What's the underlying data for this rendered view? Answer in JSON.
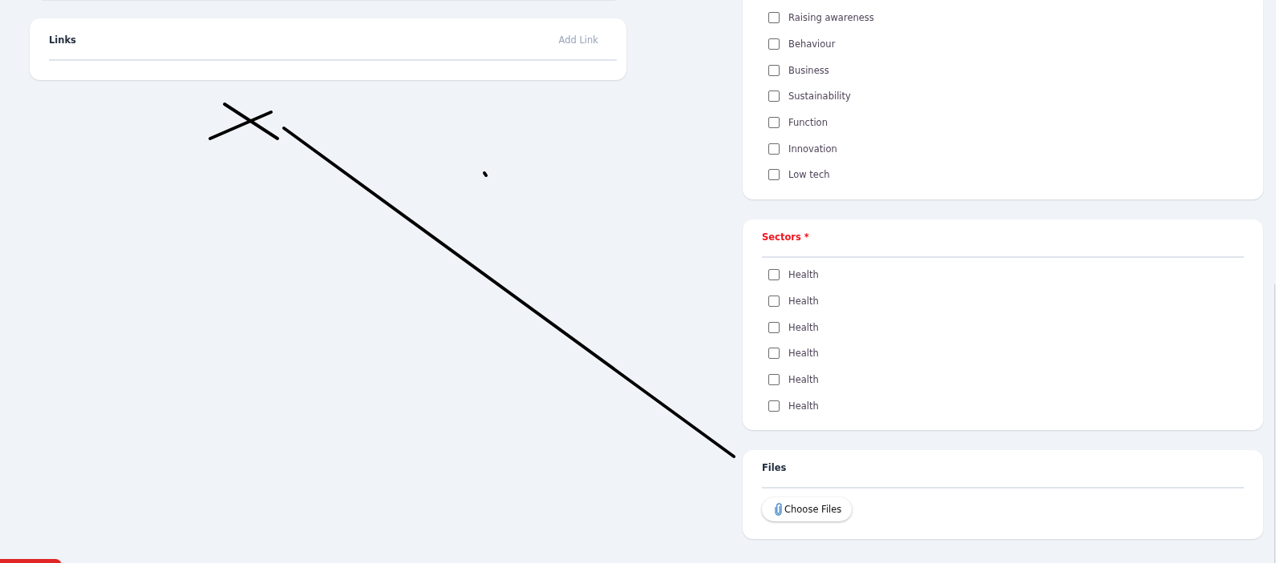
{
  "links": {
    "title": "Links",
    "add_button": "Add Link"
  },
  "categories": {
    "options": [
      {
        "label": "Raising awareness",
        "checked": false
      },
      {
        "label": "Behaviour",
        "checked": false
      },
      {
        "label": "Business",
        "checked": false
      },
      {
        "label": "Sustainability",
        "checked": false
      },
      {
        "label": "Function",
        "checked": false
      },
      {
        "label": "Innovation",
        "checked": false
      },
      {
        "label": "Low tech",
        "checked": false
      }
    ]
  },
  "sectors": {
    "title": "Sectors *",
    "required": true,
    "options": [
      {
        "label": "Health",
        "checked": false
      },
      {
        "label": "Health",
        "checked": false
      },
      {
        "label": "Health",
        "checked": false
      },
      {
        "label": "Health",
        "checked": false
      },
      {
        "label": "Health",
        "checked": false
      },
      {
        "label": "Health",
        "checked": false
      }
    ]
  },
  "files": {
    "title": "Files",
    "button": "Choose Files"
  }
}
